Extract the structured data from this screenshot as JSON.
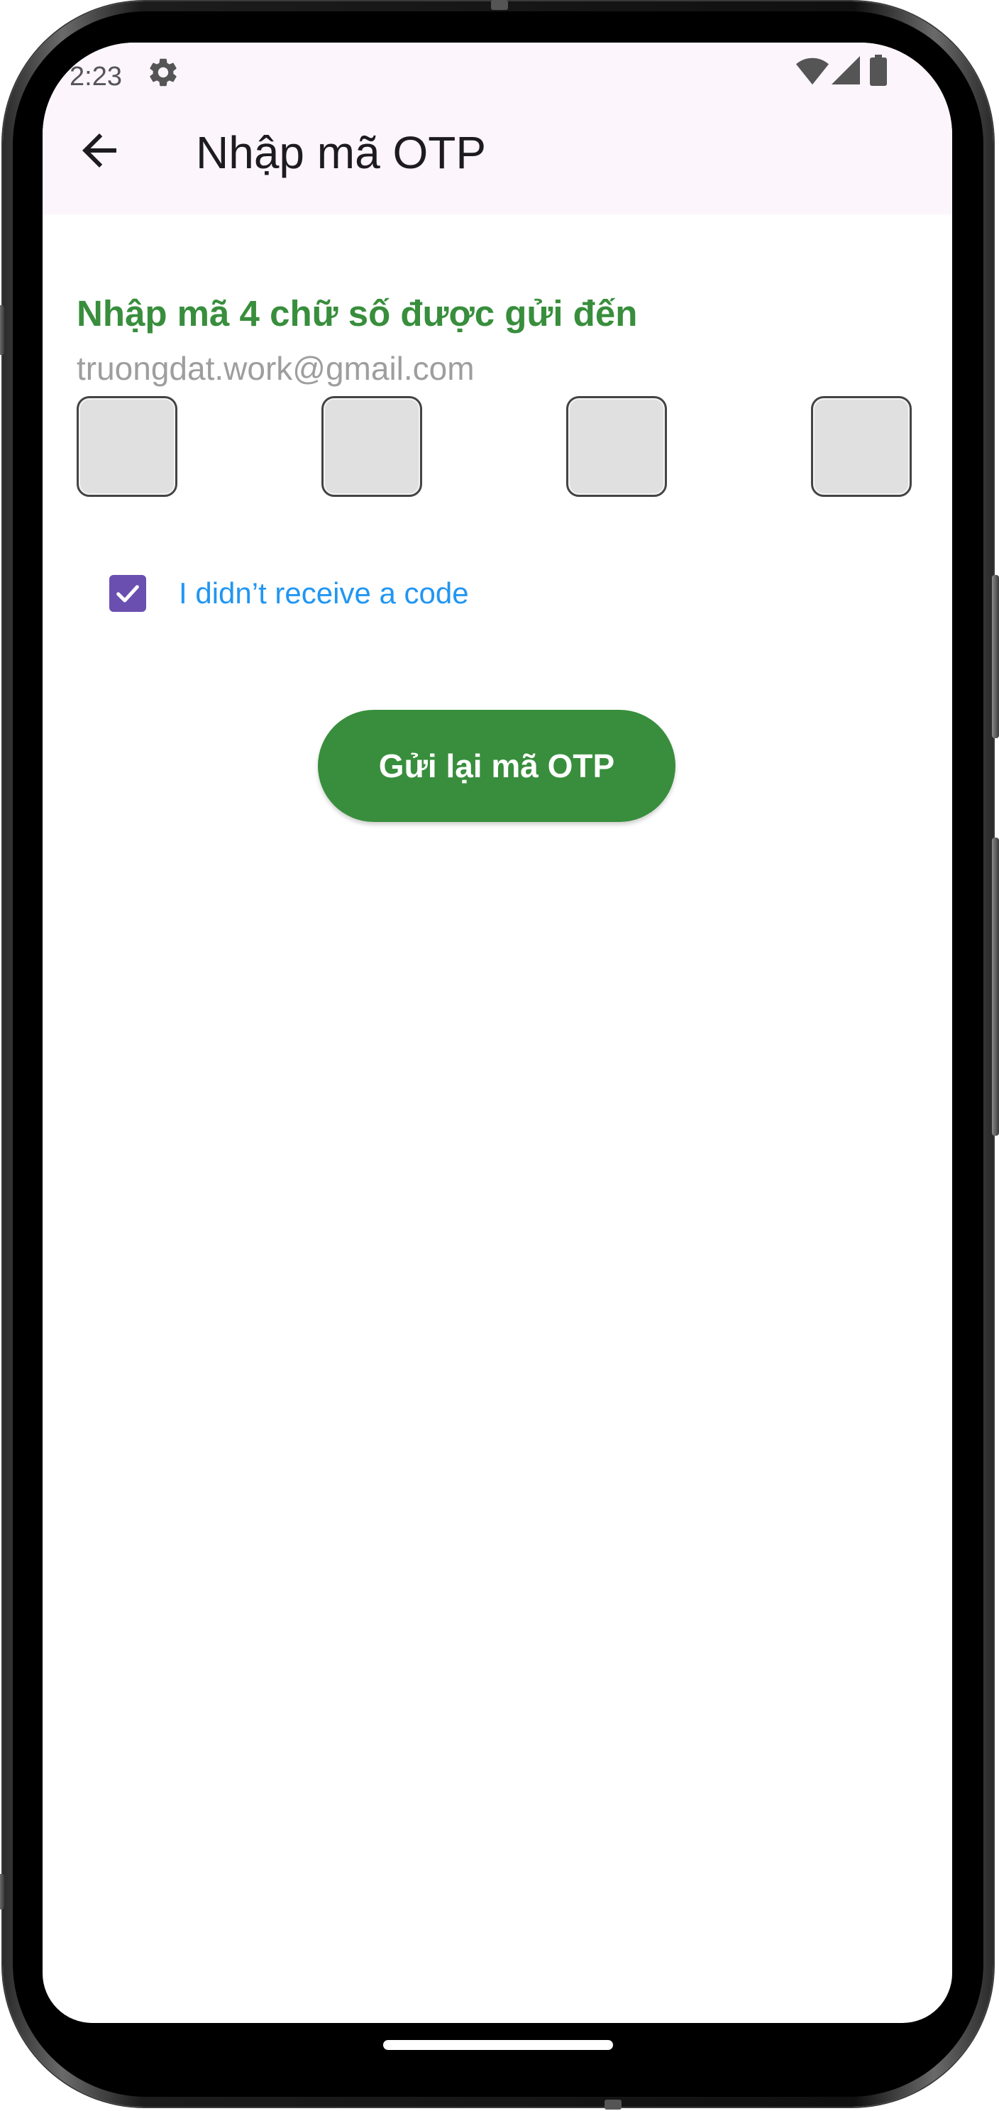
{
  "status_bar": {
    "time": "2:23",
    "settings_icon": "gear-icon",
    "wifi_icon": "wifi-icon",
    "signal_icon": "cell-signal-icon",
    "battery_icon": "battery-icon"
  },
  "app_bar": {
    "back_icon": "arrow-back-icon",
    "title": "Nhập mã OTP",
    "background": "#fcf5fc"
  },
  "content": {
    "heading": "Nhập mã 4 chữ số được gửi đến",
    "email": "truongdat.work@gmail.com",
    "otp_boxes": [
      "",
      "",
      "",
      ""
    ],
    "checkbox": {
      "checked": true,
      "label": "I didn’t receive a code"
    },
    "resend_button": "Gửi lại mã OTP"
  },
  "colors": {
    "accent_green": "#388e3c",
    "link_blue": "#2196f3",
    "checkbox_purple": "#6a4fb0",
    "email_gray": "#9e9e9e"
  }
}
